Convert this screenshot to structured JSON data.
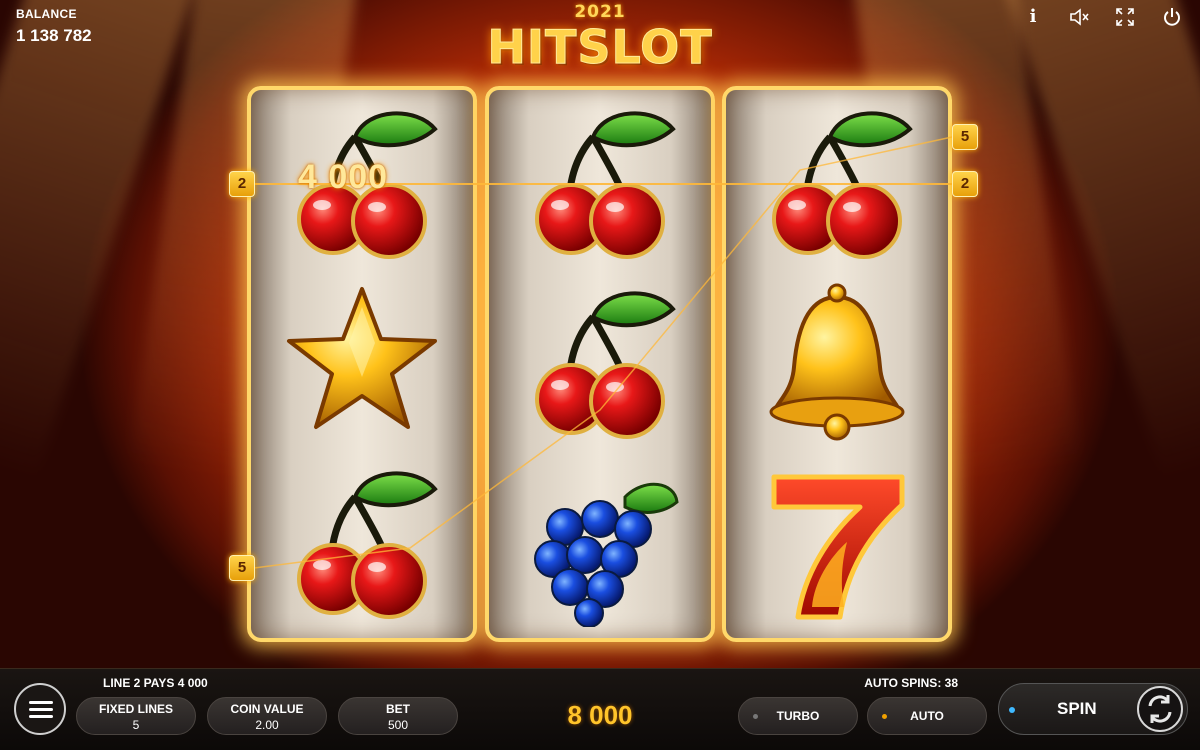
{
  "header": {
    "balance_label": "BALANCE",
    "balance_value": "1 138 782",
    "logo_year": "2021",
    "logo_title": "HITSLOT",
    "icons": [
      "info-icon",
      "sound-muted-icon",
      "fullscreen-icon",
      "power-icon"
    ],
    "info_glyph": "i"
  },
  "reels": [
    [
      "cherry",
      "star",
      "cherry"
    ],
    [
      "cherry",
      "cherry",
      "grapes"
    ],
    [
      "cherry",
      "bell",
      "seven"
    ]
  ],
  "win": {
    "amount": "4 000",
    "line_badges": [
      {
        "label": "2",
        "side": "left"
      },
      {
        "label": "5",
        "side": "left"
      },
      {
        "label": "5",
        "side": "right"
      },
      {
        "label": "2",
        "side": "right"
      }
    ]
  },
  "bottom": {
    "line_pays": "LINE 2 PAYS 4 000",
    "auto_spins": "AUTO SPINS: 38",
    "fixed_lines_label": "FIXED LINES",
    "fixed_lines_value": "5",
    "coin_value_label": "COIN VALUE",
    "coin_value_value": "2.00",
    "bet_label": "BET",
    "bet_value": "500",
    "total_win": "8 000",
    "turbo_label": "TURBO",
    "auto_label": "AUTO",
    "spin_label": "SPIN"
  },
  "colors": {
    "accent_gold": "#ffc42a",
    "badge": "#f0b020",
    "spin_dot": "#3fb9ff",
    "auto_dot": "#f0a000"
  }
}
